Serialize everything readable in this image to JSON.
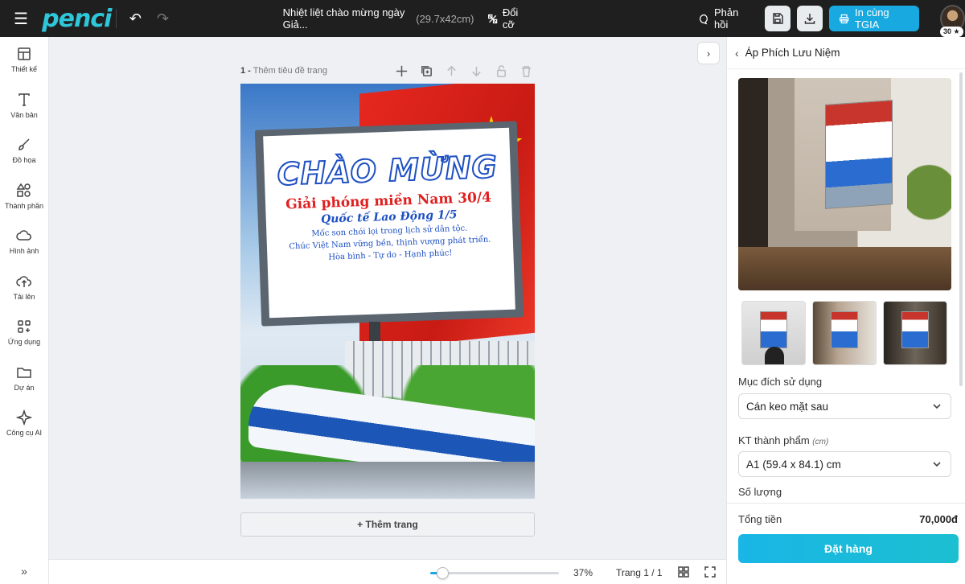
{
  "app": {
    "logo": "penci"
  },
  "document": {
    "title": "Nhiệt liệt chào mừng ngày Giả...",
    "size": "(29.7x42cm)",
    "resize_label": "Đổi cỡ"
  },
  "topbar": {
    "feedback_label": "Phản hồi",
    "print_label": "In cùng TGIA",
    "avatar_badge": "30 ★"
  },
  "sidebar": {
    "items": [
      {
        "label": "Thiết kế",
        "icon": "layout-icon"
      },
      {
        "label": "Văn bản",
        "icon": "text-icon"
      },
      {
        "label": "Đồ họa",
        "icon": "brush-icon"
      },
      {
        "label": "Thành phần",
        "icon": "shapes-icon"
      },
      {
        "label": "Hình ảnh",
        "icon": "image-icon"
      },
      {
        "label": "Tải lên",
        "icon": "upload-icon"
      },
      {
        "label": "Ứng dụng",
        "icon": "apps-icon"
      },
      {
        "label": "Dự án",
        "icon": "folder-icon"
      },
      {
        "label": "Công cụ AI",
        "icon": "sparkle-icon"
      }
    ]
  },
  "canvas": {
    "page_number": "1 -",
    "page_title_placeholder": "Thêm tiêu đề trang",
    "add_page_label": "+ Thêm trang",
    "poster": {
      "title": "CHÀO MỪNG",
      "subtitle1": "Giải phóng miền Nam 30/4",
      "subtitle2": "Quốc tế Lao Động 1/5",
      "lines": [
        "Mốc son chói lọi trong lịch sử dân tộc.",
        "Chúc Việt Nam vững bền, thịnh vượng phát triển.",
        "Hòa bình - Tự do - Hạnh phúc!"
      ]
    }
  },
  "bottombar": {
    "zoom": "37%",
    "zoom_fraction": 0.37,
    "pager": "Trang 1 / 1"
  },
  "panel": {
    "title": "Áp Phích Lưu Niệm",
    "usage_label": "Mục đích sử dụng",
    "usage_value": "Cán keo mặt sau",
    "size_label": "KT thành phẩm",
    "size_unit": "(cm)",
    "size_value": "A1 (59.4 x 84.1) cm",
    "quantity_label": "Số lượng",
    "total_label": "Tổng tiền",
    "total_value": "70,000đ",
    "order_label": "Đặt hàng"
  },
  "colors": {
    "accent": "#17a9e0",
    "topbar": "#1f1f1f",
    "logo": "#2ec6d8"
  }
}
